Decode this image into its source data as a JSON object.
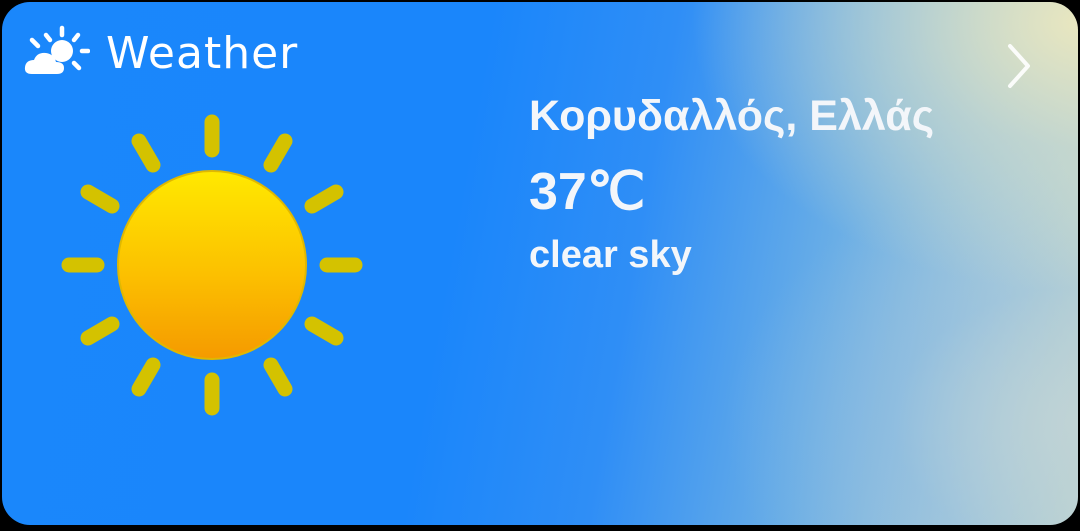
{
  "app": {
    "name": "Weather",
    "icon": "partly-sunny-icon"
  },
  "weather": {
    "location": "Κορυδαλλός, Ελλάς",
    "temperature": "37℃",
    "description": "clear sky",
    "condition_icon": "sun-icon"
  },
  "navigation": {
    "open_icon": "chevron-right-icon"
  },
  "colors": {
    "sun_core_top": "#FFE600",
    "sun_core_bottom": "#F7A000",
    "sun_rays": "#D6C300",
    "gradient_left": "#1A87FB",
    "gradient_right": "#E8E6C0",
    "text": "#FFFFFF"
  }
}
